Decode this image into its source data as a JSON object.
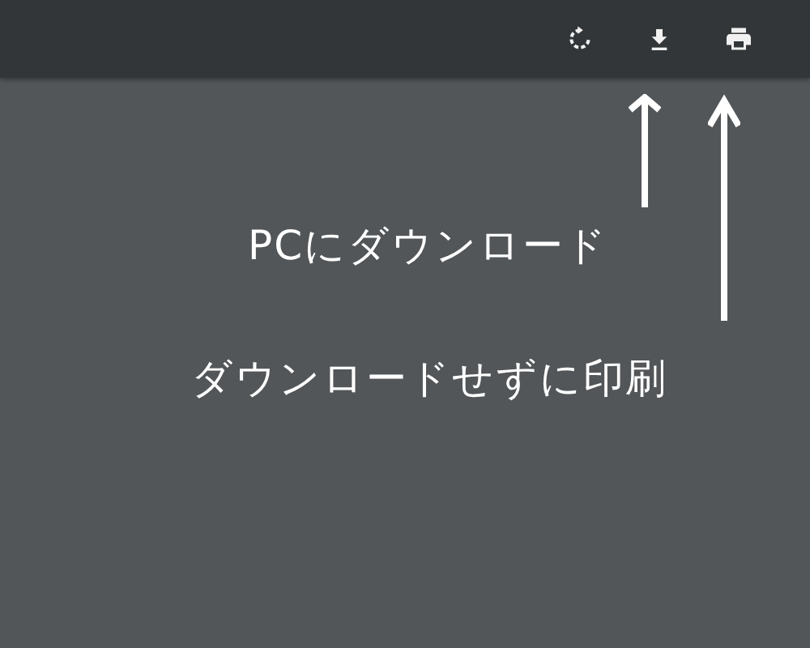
{
  "annotations": [
    {
      "label": "PCにダウンロード"
    },
    {
      "label": "ダウンロードせずに印刷"
    }
  ]
}
